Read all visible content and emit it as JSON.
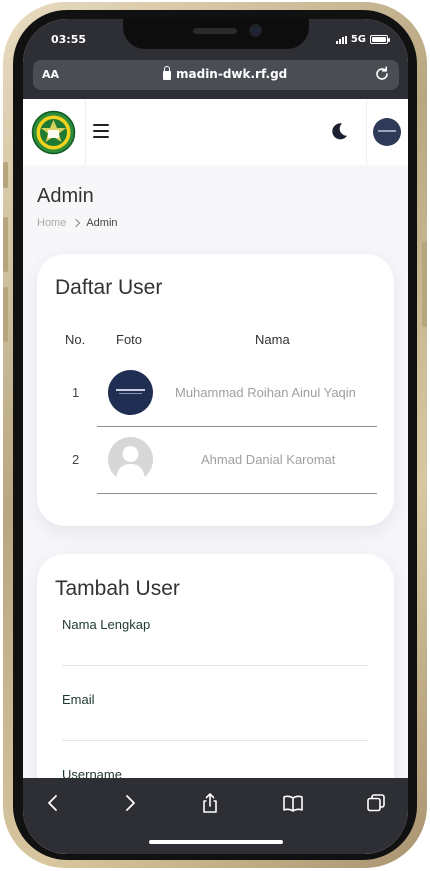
{
  "status_bar": {
    "time": "03:55",
    "network": "5G"
  },
  "browser": {
    "text_size_label": "AA",
    "url": "madin-dwk.rf.gd"
  },
  "page": {
    "title": "Admin",
    "breadcrumb": {
      "home": "Home",
      "current": "Admin"
    }
  },
  "user_list": {
    "title": "Daftar User",
    "headers": {
      "no": "No.",
      "photo": "Foto",
      "name": "Nama"
    },
    "rows": [
      {
        "no": "1",
        "name": "Muhammad Roihan Ainul Yaqin"
      },
      {
        "no": "2",
        "name": "Ahmad Danial Karomat"
      }
    ]
  },
  "add_user": {
    "title": "Tambah User",
    "fields": {
      "full_name_label": "Nama Lengkap",
      "email_label": "Email",
      "username_label": "Username"
    }
  },
  "icons": {
    "menu": "hamburger-menu-icon",
    "theme": "moon-icon",
    "toolbar": [
      "back-icon",
      "forward-icon",
      "share-icon",
      "bookmarks-icon",
      "tabs-icon"
    ]
  },
  "colors": {
    "browser_chrome": "#2d2f34",
    "avatar": "#2e3a57",
    "label_green": "#1f3b2c"
  }
}
